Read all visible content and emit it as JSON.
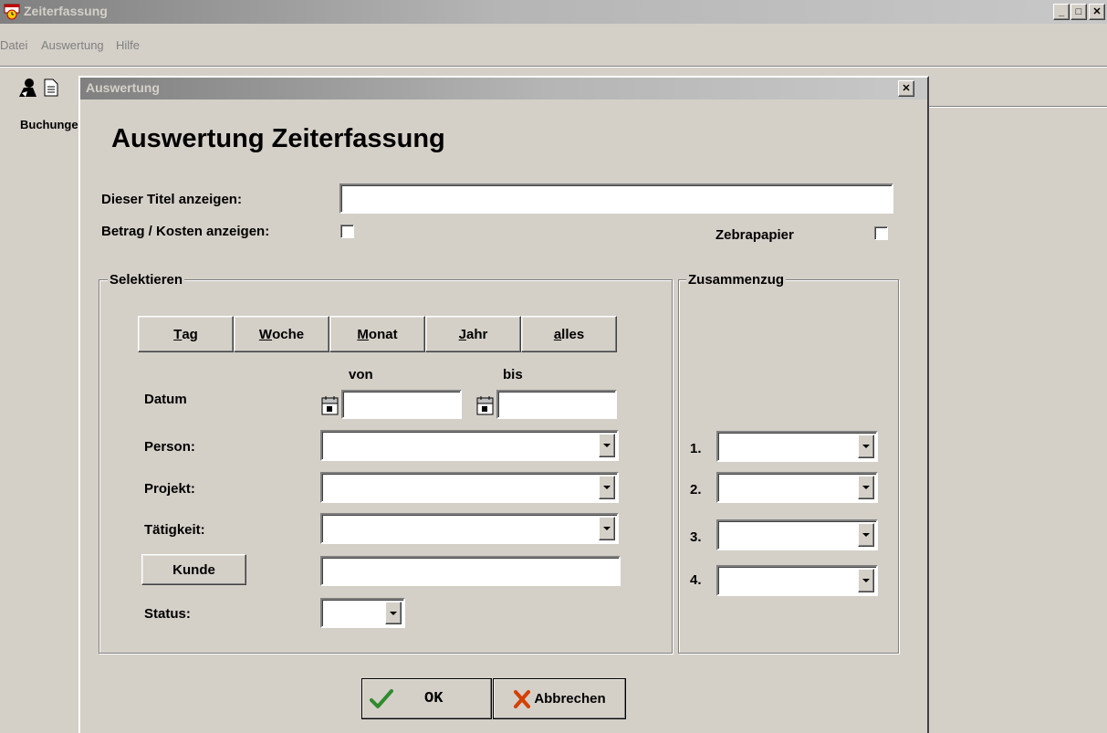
{
  "window": {
    "title": "Zeiterfassung",
    "controls": {
      "minimize": "_",
      "maximize": "□",
      "close": "✕"
    }
  },
  "menu": [
    "Datei",
    "Auswertung",
    "Hilfe"
  ],
  "background": {
    "label": "Buchungen"
  },
  "dialog": {
    "title": "Auswertung",
    "close": "✕",
    "heading": "Auswertung Zeiterfassung",
    "title_label": "Dieser Titel anzeigen:",
    "title_value": "",
    "betrag_label": "Betrag / Kosten anzeigen:",
    "zebra_label": "Zebrapapier",
    "select_group": {
      "label": "Selektieren",
      "period_buttons": [
        {
          "key": "T",
          "rest": "ag"
        },
        {
          "key": "W",
          "rest": "oche"
        },
        {
          "key": "M",
          "rest": "onat"
        },
        {
          "key": "J",
          "rest": "ahr"
        },
        {
          "key": "a",
          "rest": "lles"
        }
      ],
      "von": "von",
      "bis": "bis",
      "datum": "Datum",
      "datum_von": "",
      "datum_bis": "",
      "person": "Person:",
      "projekt": "Projekt:",
      "taetigkeit": "Tätigkeit:",
      "kunde_button": "Kunde",
      "kunde_value": "",
      "status": "Status:"
    },
    "summary_group": {
      "label": "Zusammenzug",
      "numbers": [
        "1.",
        "2.",
        "3.",
        "4."
      ]
    },
    "ok": "OK",
    "cancel": "Abbrechen"
  },
  "colors": {
    "face": "#d4d0c8",
    "shadow": "#808080",
    "highlight": "#ffffff",
    "ok_check": "#2e8b2e",
    "cancel_x": "#d44000"
  }
}
